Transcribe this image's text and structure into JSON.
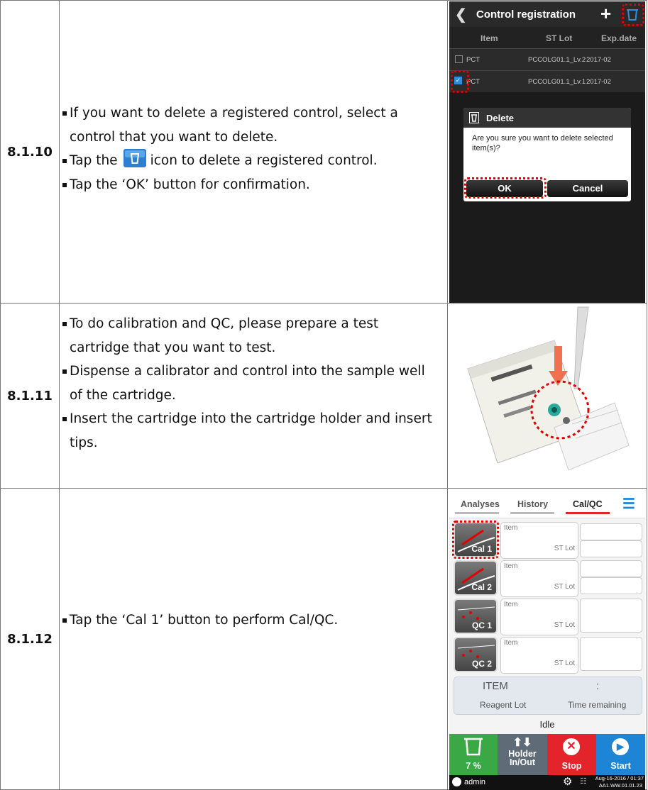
{
  "rows": [
    {
      "step": "8.1.10",
      "bullets": [
        "If you want to delete a registered control, select a control that you want to delete.",
        "Tap the",
        "icon to delete a registered control.",
        "Tap the ‘OK’ button for confirmation."
      ]
    },
    {
      "step": "8.1.11",
      "bullets": [
        "To do calibration and QC, please prepare a test cartridge that you want to test.",
        "Dispense a calibrator and control into the sample well of the cartridge.",
        "Insert the cartridge into the cartridge holder and insert tips."
      ]
    },
    {
      "step": "8.1.12",
      "bullets": [
        "Tap the ‘Cal 1’ button to perform Cal/QC."
      ]
    }
  ],
  "screen1": {
    "title": "Control registration",
    "columns": [
      "Item",
      "ST Lot",
      "Exp.date"
    ],
    "rows": [
      {
        "item": "PCT",
        "lot": "PCCOLG01.1_Lv.2",
        "exp": "2017-02",
        "checked": false
      },
      {
        "item": "PCT",
        "lot": "PCCOLG01.1_Lv.1",
        "exp": "2017-02",
        "checked": true
      }
    ],
    "dialog": {
      "title": "Delete",
      "message": "Are you sure you want to delete selected item(s)?",
      "ok": "OK",
      "cancel": "Cancel"
    }
  },
  "screen3": {
    "tabs": [
      "Analyses",
      "History",
      "Cal/QC"
    ],
    "buttons": [
      "Cal 1",
      "Cal 2",
      "QC 1",
      "QC 2"
    ],
    "item_label": "Item",
    "lot_label": "ST Lot",
    "panel": {
      "item": "ITEM",
      "colon": ":",
      "reagent": "Reagent Lot",
      "time": "Time remaining"
    },
    "state": "Idle",
    "bottom": {
      "trash_pct": "7 %",
      "holder": "Holder In/Out",
      "stop": "Stop",
      "start": "Start"
    },
    "status": {
      "user": "admin",
      "date": "Aug-16-2016 / 01:37",
      "version": "AA1.WW.01.01.23"
    }
  },
  "colors": {
    "accent_red": "#e30000",
    "green": "#3aa845",
    "blue": "#1e84d6",
    "stop_red": "#e3242b"
  }
}
